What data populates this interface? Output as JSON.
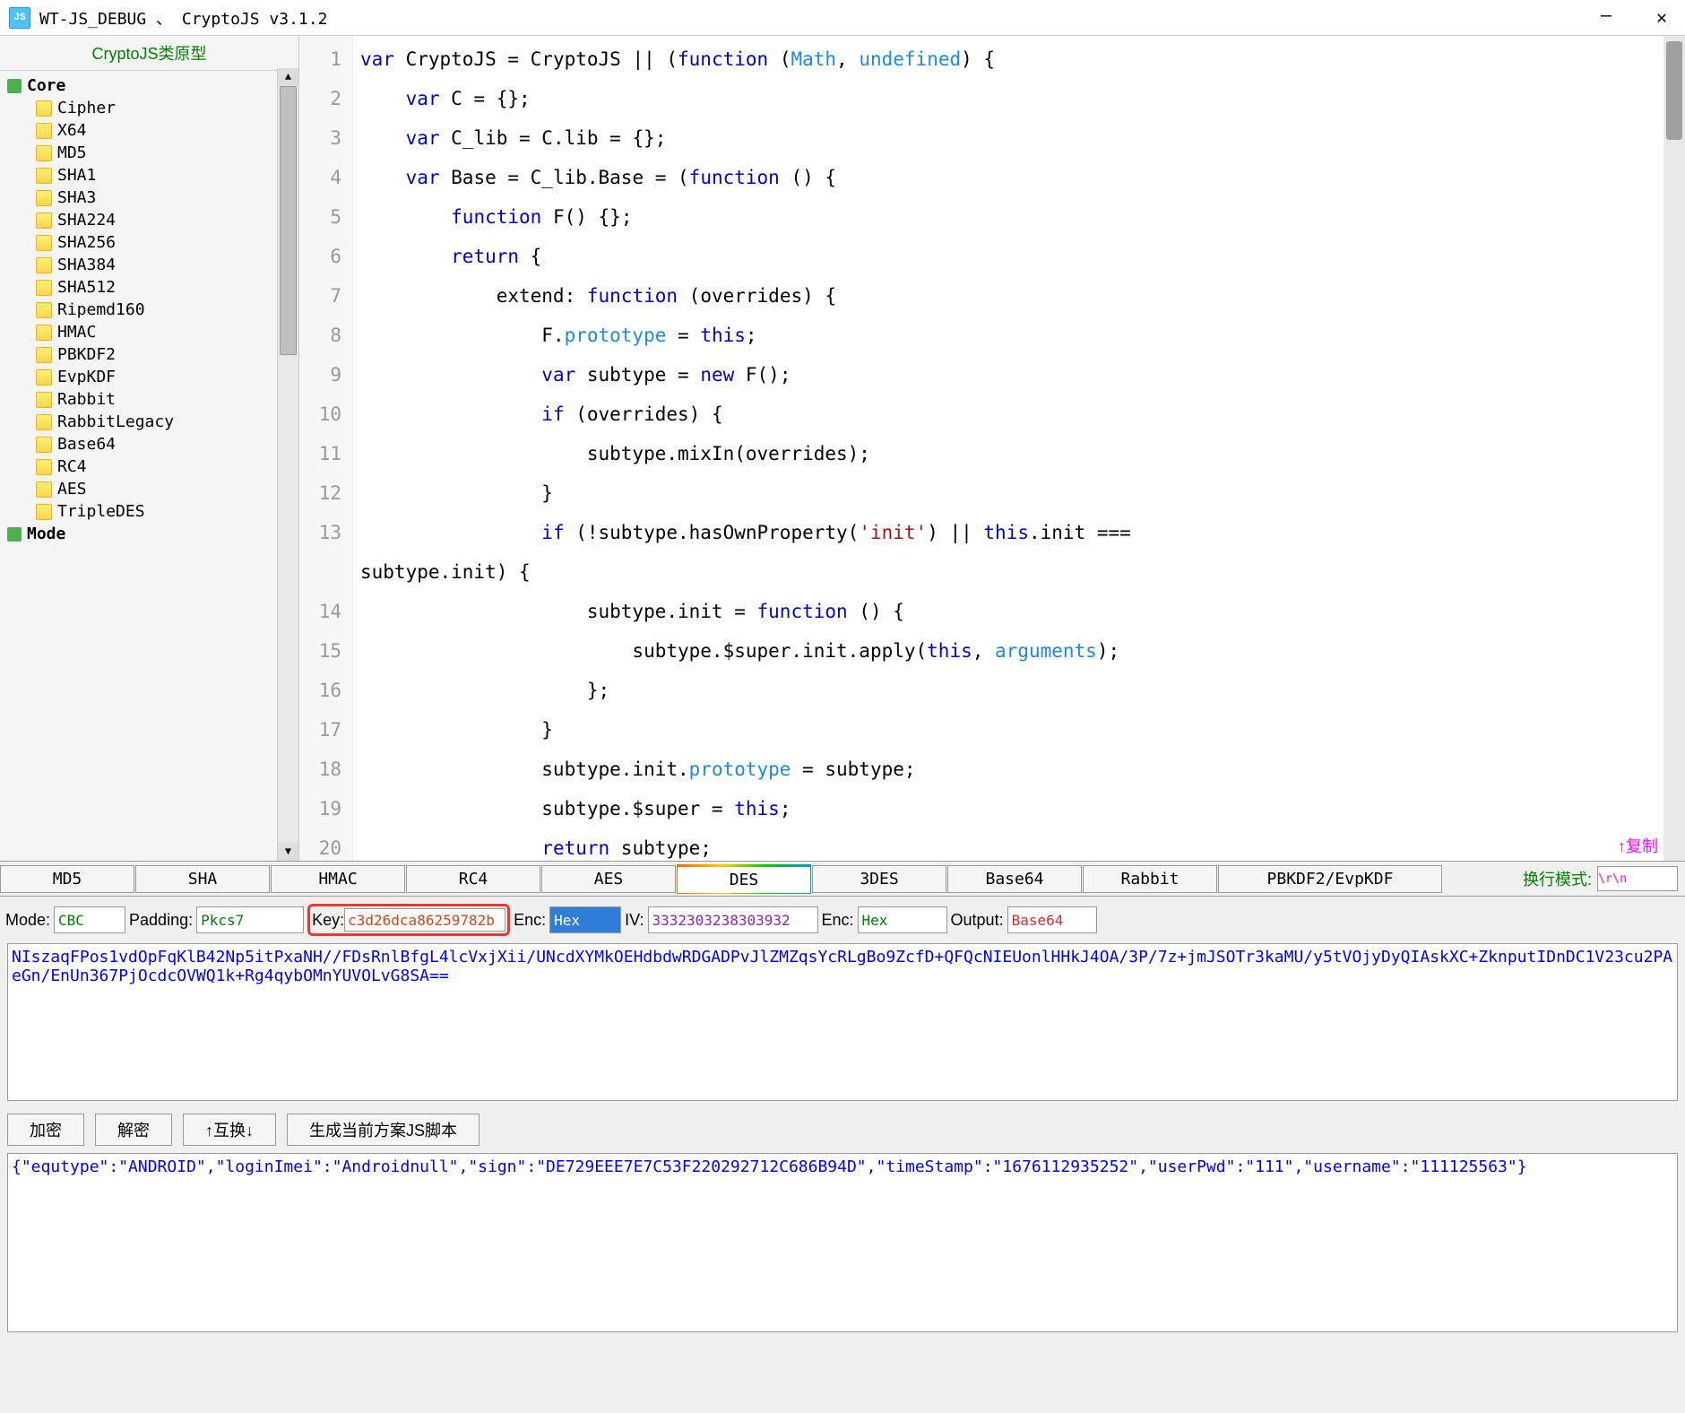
{
  "window": {
    "icon_text": "JS",
    "title": "WT-JS_DEBUG 、 CryptoJS v3.1.2"
  },
  "sidebar": {
    "header": "CryptoJS类原型",
    "groups": [
      {
        "name": "Core",
        "items": [
          "Cipher",
          "X64",
          "MD5",
          "SHA1",
          "SHA3",
          "SHA224",
          "SHA256",
          "SHA384",
          "SHA512",
          "Ripemd160",
          "HMAC",
          "PBKDF2",
          "EvpKDF",
          "Rabbit",
          "RabbitLegacy",
          "Base64",
          "RC4",
          "AES",
          "TripleDES"
        ]
      },
      {
        "name": "Mode",
        "items": []
      }
    ]
  },
  "code": {
    "lines": [
      {
        "n": 1,
        "raw": "var CryptoJS = CryptoJS || (function (Math, undefined) {"
      },
      {
        "n": 2,
        "raw": "    var C = {};"
      },
      {
        "n": 3,
        "raw": "    var C_lib = C.lib = {};"
      },
      {
        "n": 4,
        "raw": "    var Base = C_lib.Base = (function () {"
      },
      {
        "n": 5,
        "raw": "        function F() {};"
      },
      {
        "n": 6,
        "raw": "        return {"
      },
      {
        "n": 7,
        "raw": "            extend: function (overrides) {"
      },
      {
        "n": 8,
        "raw": "                F.prototype = this;"
      },
      {
        "n": 9,
        "raw": "                var subtype = new F();"
      },
      {
        "n": 10,
        "raw": "                if (overrides) {"
      },
      {
        "n": 11,
        "raw": "                    subtype.mixIn(overrides);"
      },
      {
        "n": 12,
        "raw": "                }"
      },
      {
        "n": 13,
        "raw": "                if (!subtype.hasOwnProperty('init') || this.init === subtype.init) {"
      },
      {
        "n": 14,
        "raw": "                    subtype.init = function () {"
      },
      {
        "n": 15,
        "raw": "                        subtype.$super.init.apply(this, arguments);"
      },
      {
        "n": 16,
        "raw": "                    };"
      },
      {
        "n": 17,
        "raw": "                }"
      },
      {
        "n": 18,
        "raw": "                subtype.init.prototype = subtype;"
      },
      {
        "n": 19,
        "raw": "                subtype.$super = this;"
      },
      {
        "n": 20,
        "raw": "                return subtype;"
      }
    ],
    "copy_label": "↑复制"
  },
  "tabs": {
    "items": [
      "MD5",
      "SHA",
      "HMAC",
      "RC4",
      "AES",
      "DES",
      "3DES",
      "Base64",
      "Rabbit",
      "PBKDF2/EvpKDF"
    ],
    "active": "DES",
    "wrap_label": "换行模式:",
    "wrap_value": "\\r\\n"
  },
  "params": {
    "mode_label": "Mode:",
    "mode": "CBC",
    "padding_label": "Padding:",
    "padding": "Pkcs7",
    "key_label": "Key:",
    "key": "c3d26dca86259782b",
    "enc1_label": "Enc:",
    "enc1": "Hex",
    "iv_label": "IV:",
    "iv": "3332303238303932",
    "enc2_label": "Enc:",
    "enc2": "Hex",
    "output_label": "Output:",
    "output": "Base64"
  },
  "cipher_text": "NIszaqFPos1vdOpFqKlB42Np5itPxaNH//FDsRnlBfgL4lcVxjXii/UNcdXYMkOEHdbdwRDGADPvJlZMZqsYcRLgBo9ZcfD+QFQcNIEUonlHHkJ4OA/3P/7z+jmJSOTr3kaMU/y5tVOjyDyQIAskXC+ZknputIDnDC1V23cu2PAeGn/EnUn367PjOcdcOVWQ1k+Rg4qybOMnYUVOLvG8SA==",
  "buttons": {
    "encrypt": "加密",
    "decrypt": "解密",
    "swap": "↑互换↓",
    "genscript": "生成当前方案JS脚本"
  },
  "plain_text": "{\"equtype\":\"ANDROID\",\"loginImei\":\"Androidnull\",\"sign\":\"DE729EEE7E7C53F220292712C686B94D\",\"timeStamp\":\"1676112935252\",\"userPwd\":\"111\",\"username\":\"111125563\"}"
}
